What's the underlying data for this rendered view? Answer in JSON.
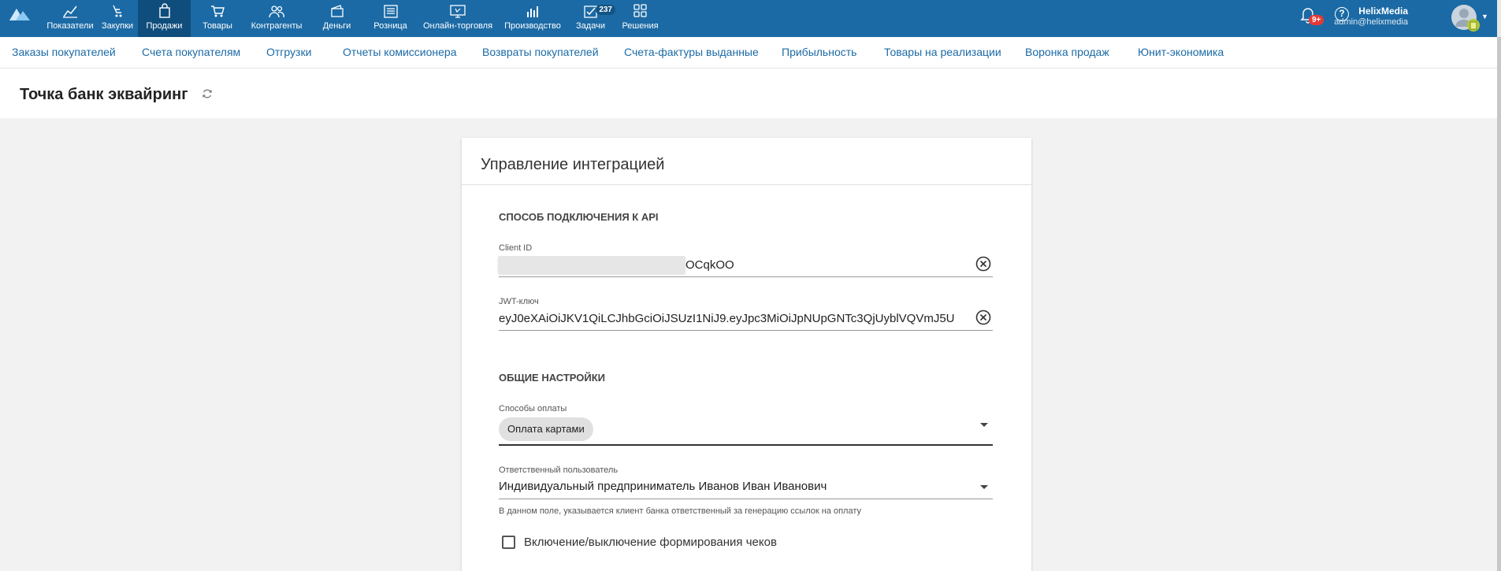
{
  "topnav": {
    "items": [
      {
        "label": "Показатели",
        "icon": "chart-line-icon"
      },
      {
        "label": "Закупки",
        "icon": "purchase-icon"
      },
      {
        "label": "Продажи",
        "icon": "shopping-bag-icon",
        "active": true
      },
      {
        "label": "Товары",
        "icon": "cart-icon"
      },
      {
        "label": "Контрагенты",
        "icon": "people-icon"
      },
      {
        "label": "Деньги",
        "icon": "wallet-icon"
      },
      {
        "label": "Розница",
        "icon": "cash-register-icon"
      },
      {
        "label": "Онлайн-торговля",
        "icon": "online-store-icon"
      },
      {
        "label": "Производство",
        "icon": "bar-chart-icon"
      },
      {
        "label": "Задачи",
        "icon": "tasks-icon",
        "badge": "237"
      },
      {
        "label": "Решения",
        "icon": "apps-grid-icon"
      }
    ],
    "notifications_badge": "9+",
    "help_icon": "?",
    "user_name": "HelixMedia",
    "user_email": "admin@helixmedia",
    "brand_color": "#1b6aa5"
  },
  "subnav": {
    "items": [
      "Заказы покупателей",
      "Счета покупателям",
      "Отгрузки",
      "Отчеты комиссионера",
      "Возвраты покупателей",
      "Счета-фактуры выданные",
      "Прибыльность",
      "Товары на реализации",
      "Воронка продаж",
      "Юнит-экономика"
    ]
  },
  "page": {
    "title": "Точка банк эквайринг"
  },
  "card": {
    "title": "Управление интеграцией",
    "api_section": "СПОСОБ ПОДКЛЮЧЕНИЯ К API",
    "client_id_label": "Client ID",
    "client_id_value": "OCqkOO",
    "jwt_label": "JWT-ключ",
    "jwt_value": "eyJ0eXAiOiJKV1QiLCJhbGciOiJSUzI1NiJ9.eyJpc3MiOiJpNUpGNTc3QjUyblVQVmJ5U",
    "general_section": "ОБЩИЕ НАСТРОЙКИ",
    "payment_label": "Способы оплаты",
    "payment_chip": "Оплата картами",
    "responsible_label": "Ответственный пользователь",
    "responsible_value": "Индивидуальный предприниматель Иванов Иван Иванович",
    "responsible_hint": "В данном поле, указывается клиент банка ответственный за генерацию ссылок на оплату",
    "receipts_checkbox_label": "Включение/выключение формирования чеков",
    "receipts_checked": false
  }
}
